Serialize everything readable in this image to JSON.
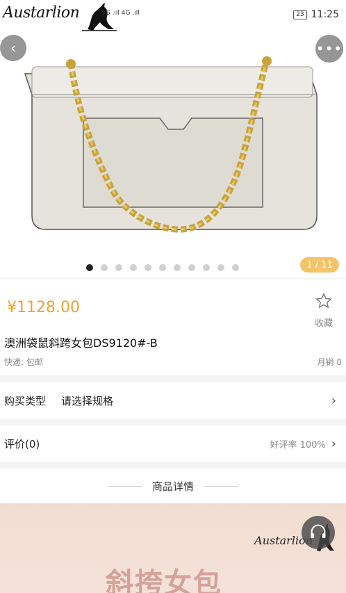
{
  "status_bar": {
    "brand": "Austarlion",
    "signal": "5G .ıll 4G .ıll",
    "battery": "23",
    "time": "11:25"
  },
  "nav": {
    "back_icon": "chevron-left-icon",
    "more_icon": "more-dots-icon"
  },
  "gallery": {
    "total_dots": 11,
    "active_index": 0,
    "counter": "1 / 11"
  },
  "product": {
    "price": "¥1128.00",
    "favorite_label": "收藏",
    "title": "澳洲袋鼠斜跨女包DS9120#-B",
    "shipping": "快递: 包邮",
    "sales": "月销 0"
  },
  "spec_row": {
    "label": "购买类型",
    "value": "请选择规格"
  },
  "review_row": {
    "label": "评价(0)",
    "rate": "好评率 100%"
  },
  "details": {
    "heading": "商品详情",
    "banner_brand": "Austarlion",
    "banner_text": "斜挎女包"
  },
  "colors": {
    "price": "#f0a030",
    "counter_badge": "#f4c36a",
    "banner_bg": "#f2ddd2",
    "banner_text": "#d4a29a"
  }
}
